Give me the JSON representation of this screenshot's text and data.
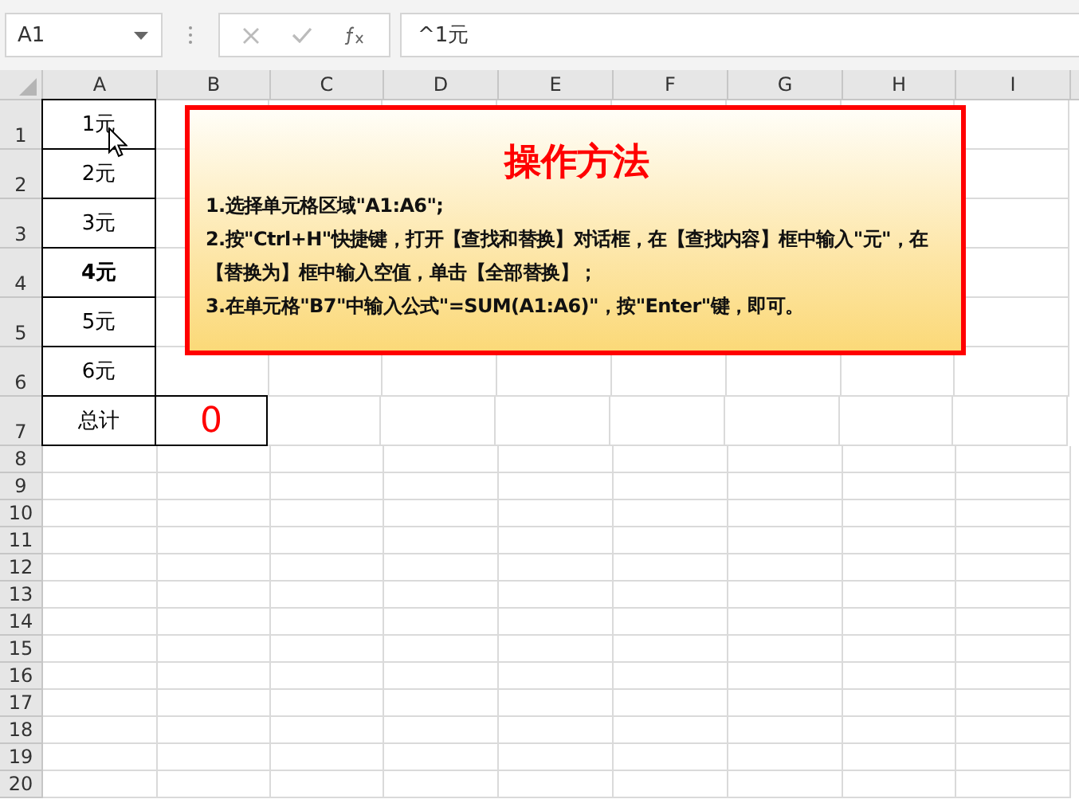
{
  "name_box": "A1",
  "formula": "^1元",
  "columns": [
    "A",
    "B",
    "C",
    "D",
    "E",
    "F",
    "G",
    "H",
    "I"
  ],
  "rows": [
    {
      "header": "1",
      "a": "1元",
      "bold": false
    },
    {
      "header": "2",
      "a": "2元",
      "bold": false
    },
    {
      "header": "3",
      "a": "3元",
      "bold": false
    },
    {
      "header": "4",
      "a": "4元",
      "bold": true
    },
    {
      "header": "5",
      "a": "5元",
      "bold": false
    },
    {
      "header": "6",
      "a": "6元",
      "bold": false
    },
    {
      "header": "7",
      "a": "总计",
      "b": "0",
      "bold": false
    },
    {
      "header": "8"
    },
    {
      "header": "9"
    },
    {
      "header": "10"
    },
    {
      "header": "11"
    },
    {
      "header": "12"
    },
    {
      "header": "13"
    },
    {
      "header": "14"
    },
    {
      "header": "15"
    },
    {
      "header": "16"
    },
    {
      "header": "17"
    },
    {
      "header": "18"
    },
    {
      "header": "19"
    },
    {
      "header": "20"
    }
  ],
  "note": {
    "title": "操作方法",
    "lines": [
      "1.选择单元格区域\"A1:A6\";",
      "2.按\"Ctrl+H\"快捷键，打开【查找和替换】对话框，在【查找内容】框中输入\"元\"，在【替换为】框中输入空值，单击【全部替换】；",
      "3.在单元格\"B7\"中输入公式\"=SUM(A1:A6)\"，按\"Enter\"键，即可。"
    ]
  }
}
